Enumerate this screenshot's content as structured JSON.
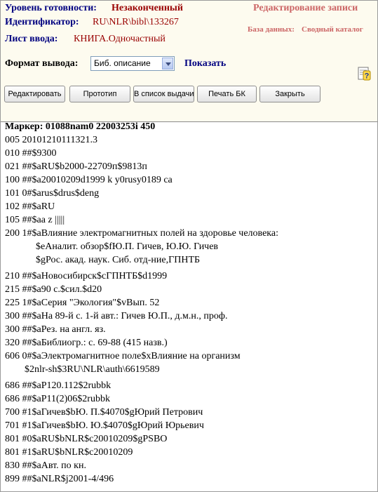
{
  "header": {
    "level_label": "Уровень готовности:",
    "level_value": "Незаконченный",
    "id_label": "Идентификатор:",
    "id_value": "RU\\NLR\\bibl\\133267",
    "sheet_label": "Лист ввода:",
    "sheet_value": "КНИГА.Одночастный",
    "edit_title": "Редактирование записи",
    "database_label": "База данных:",
    "database_value": "Сводный каталог"
  },
  "format": {
    "label": "Формат вывода:",
    "selected": "Биб. описание",
    "show_link": "Показать"
  },
  "toolbar": {
    "buttons": [
      "Редактировать",
      "Прототип",
      "В список выдачи",
      "Печать БК",
      "Закрыть"
    ]
  },
  "record": {
    "marker": "Маркер: 01088nam0 22003253i 450",
    "lines": [
      "005 20101210111321.3",
      "010 ##$9300",
      "021 ##$aRU$b2000-22709п$9813п",
      "100 ##$a20010209d1999 k y0rusy0189 ca",
      "101 0#$arus$drus$deng",
      "102 ##$aRU",
      "105 ##$aa z |||||",
      "200 1#$aВлияние электромагнитных полей на здоровье человека:",
      "$eАналит. обзор$fЮ.П. Гичев, Ю.Ю. Гичев",
      "$gРос. акад. наук. Сиб. отд-ние,ГПНТБ",
      "210 ##$aНовосибирск$cГПНТБ$d1999",
      "215 ##$a90 с.$cил.$d20",
      "225 1#$aСерия \"Экология\"$vВып. 52",
      "300 ##$aНа 89-й с. 1-й авт.: Гичев Ю.П., д.м.н., проф.",
      "300 ##$aРез. на англ. яз.",
      "320 ##$aБиблиогр.: с. 69-88 (415 назв.)",
      "606 0#$aЭлектромагнитное поле$xВлияние на организм",
      "$2nlr-sh$3RU\\NLR\\auth\\6619589",
      "686 ##$aP120.112$2rubbk",
      "686 ##$aP11(2)06$2rubbk",
      "700 #1$aГичев$bЮ. П.$4070$gЮрий Петрович",
      "701 #1$aГичев$bЮ. Ю.$4070$gЮрий Юрьевич",
      "801 #0$aRU$bNLR$c20010209$gPSBO",
      "801 #1$aRU$bNLR$c20010209",
      "830 ##$aАвт. по кн.",
      "899 ##$aNLR$j2001-4/496"
    ]
  }
}
